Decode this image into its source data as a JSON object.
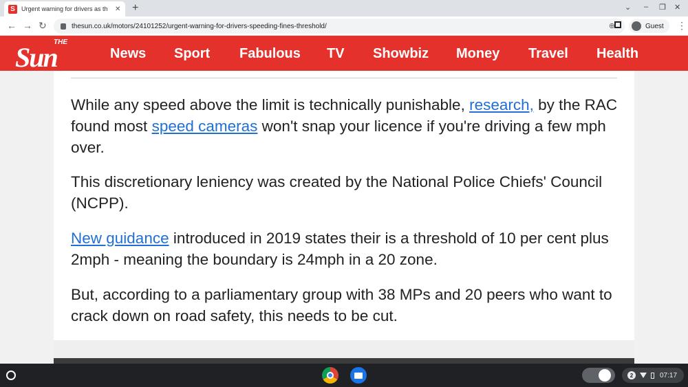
{
  "browser": {
    "tab_title": "Urgent warning for drivers as th",
    "tab_favicon_letter": "S",
    "new_tab_glyph": "+",
    "close_glyph": "✕",
    "url": "thesun.co.uk/motors/24101252/urgent-warning-for-drivers-speeding-fines-threshold/",
    "profile_label": "Guest"
  },
  "site": {
    "logo_top": "THE",
    "logo_main": "Sun",
    "nav": [
      "News",
      "Sport",
      "Fabulous",
      "TV",
      "Showbiz",
      "Money",
      "Travel",
      "Health"
    ],
    "brand_color": "#e4312b"
  },
  "article": {
    "p1": {
      "a": "While any speed above the limit is technically punishable, ",
      "link1": "research,",
      "b": " by the RAC found most ",
      "link2": "speed cameras",
      "c": " won't snap your licence if you're driving a few mph over."
    },
    "p2": "This discretionary leniency was created by the National Police Chiefs' Council (NCPP).",
    "p3": {
      "link": "New guidance",
      "rest": " introduced in 2019 states their is a threshold of 10 per cent plus 2mph - meaning the boundary is 24mph in a 20 zone."
    },
    "p4": "But, according to a parliamentary group with 38 MPs and 20 peers who want to crack down on road safety, this needs to be cut.",
    "link_color": "#1f6fd6"
  },
  "shelf": {
    "notification_count": "2",
    "time": "07:17"
  },
  "icons": [
    "launcher-icon",
    "chrome-icon",
    "files-icon",
    "wifi-icon",
    "battery-icon",
    "lock-icon",
    "zoom-icon",
    "sidepanel-icon",
    "menu-icon"
  ]
}
